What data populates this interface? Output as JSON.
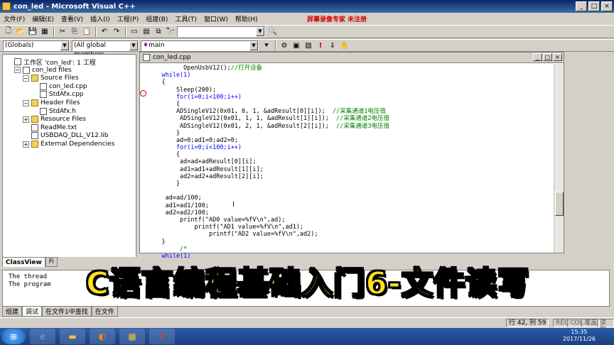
{
  "window": {
    "title": "con_led - Microsoft Visual C++",
    "min": "_",
    "max": "□",
    "close": "×"
  },
  "menu": {
    "items": [
      "文件(F)",
      "编辑(E)",
      "查看(V)",
      "插入(I)",
      "工程(P)",
      "组建(B)",
      "工具(T)",
      "窗口(W)",
      "帮助(H)"
    ],
    "watermark": "屏幕录像专家 未注册"
  },
  "toolbar2": {
    "globals": "(Globals)",
    "members": "(All global members",
    "function": "main"
  },
  "workspace": {
    "nodes": [
      {
        "label": "工作区 'con_led': 1 工程",
        "level": 0,
        "type": "ws"
      },
      {
        "label": "con_led files",
        "level": 1,
        "type": "proj"
      },
      {
        "label": "Source Files",
        "level": 2,
        "type": "folder"
      },
      {
        "label": "con_led.cpp",
        "level": 3,
        "type": "file"
      },
      {
        "label": "StdAfx.cpp",
        "level": 3,
        "type": "file"
      },
      {
        "label": "Header Files",
        "level": 2,
        "type": "folder"
      },
      {
        "label": "StdAfx.h",
        "level": 3,
        "type": "file"
      },
      {
        "label": "Resource Files",
        "level": 2,
        "type": "folder"
      },
      {
        "label": "ReadMe.txt",
        "level": 2,
        "type": "file"
      },
      {
        "label": "USBDAQ_DLL_V12.lib",
        "level": 2,
        "type": "file"
      },
      {
        "label": "External Dependencies",
        "level": 2,
        "type": "folder"
      }
    ],
    "tabs": [
      "ClassView",
      "Fi"
    ]
  },
  "editor": {
    "filename": "con_led.cpp",
    "lines": [
      {
        "t": "          OpenUsbV12();",
        "c": "//打开设备"
      },
      {
        "t": "    while(1)",
        "kw": true
      },
      {
        "t": "    {"
      },
      {
        "t": "        Sleep(200);"
      },
      {
        "t": "        for(i=0;i<100;i++)",
        "kw": true
      },
      {
        "t": "        {"
      },
      {
        "t": "        ADSingleV12(0x01, 0, 1, &adResult[0][i]);  ",
        "c": "//采集通道1电压值"
      },
      {
        "t": "         ADSingleV12(0x01, 1, 1, &adResult[1][i]);  ",
        "c": "//采集通道2电压值"
      },
      {
        "t": "         ADSingleV12(0x01, 2, 1, &adResult[2][i]);  ",
        "c": "//采集通道3电压值"
      },
      {
        "t": "        }"
      },
      {
        "t": "        ad=0;ad1=0;ad2=0;"
      },
      {
        "t": "        for(i=0;i<100;i++)",
        "kw": true
      },
      {
        "t": "        {"
      },
      {
        "t": "         ad=ad+adResult[0][i];"
      },
      {
        "t": "         ad1=ad1+adResult[1][i];"
      },
      {
        "t": "         ad2=ad2+adResult[2][i];"
      },
      {
        "t": "        }"
      },
      {
        "t": ""
      },
      {
        "t": "     ad=ad/100;"
      },
      {
        "t": "     ad1=ad1/100;"
      },
      {
        "t": "     ad2=ad2/100;"
      },
      {
        "t": "         printf(\"AD0 value=%fV\\n\",ad);"
      },
      {
        "t": "             printf(\"AD1 value=%fV\\n\",ad1);"
      },
      {
        "t": "                 printf(\"AD2 value=%fV\\n\",ad2);"
      },
      {
        "t": "    }"
      },
      {
        "t": "         /*",
        "cm": true
      },
      {
        "t": "    while(1)",
        "kw": true
      }
    ]
  },
  "output": {
    "lines": [
      "The thread",
      "The program"
    ]
  },
  "output_tabs": [
    "组建",
    "调试",
    "在文件1中查找",
    "在文件"
  ],
  "status": {
    "position": "行 42, 列 59",
    "rec": "REC",
    "col": "COL",
    "ovr": "覆盖",
    "read": "读取"
  },
  "taskbar": {
    "time": "15:35",
    "date": "2017/11/26"
  },
  "banner": {
    "text": "C语言编程基础入门6-文件读写"
  }
}
